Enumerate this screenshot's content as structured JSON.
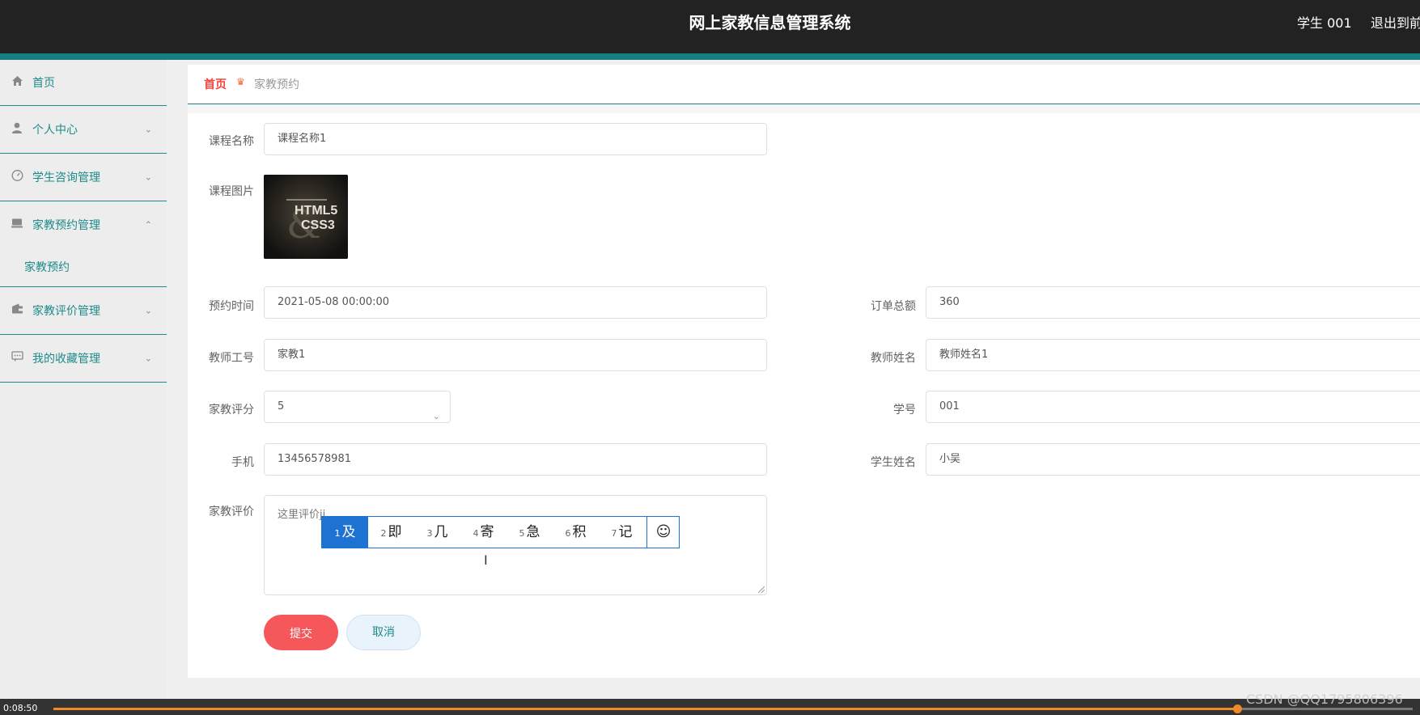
{
  "header": {
    "app_title": "网上家教信息管理系统",
    "user_name": "学生 001",
    "logout_label": "退出到前台"
  },
  "sidebar": {
    "items": [
      {
        "label": "首页",
        "icon": "home-icon"
      },
      {
        "label": "个人中心",
        "icon": "user-icon"
      },
      {
        "label": "学生咨询管理",
        "icon": "dashboard-icon"
      },
      {
        "label": "家教预约管理",
        "icon": "inbox-icon",
        "expanded": true
      },
      {
        "label": "家教评价管理",
        "icon": "wallet-icon"
      },
      {
        "label": "我的收藏管理",
        "icon": "chat-icon"
      }
    ],
    "subitem": {
      "label": "家教预约"
    }
  },
  "breadcrumb": {
    "home": "首页",
    "current": "家教预约"
  },
  "form": {
    "course_name": {
      "label": "课程名称",
      "value": "课程名称1"
    },
    "course_image": {
      "label": "课程图片",
      "line1": "HTML5",
      "line2": "CSS3"
    },
    "booking_time": {
      "label": "预约时间",
      "value": "2021-05-08 00:00:00"
    },
    "order_total": {
      "label": "订单总额",
      "value": "360"
    },
    "teacher_id": {
      "label": "教师工号",
      "value": "家教1"
    },
    "teacher_name": {
      "label": "教师姓名",
      "value": "教师姓名1"
    },
    "rating": {
      "label": "家教评分",
      "value": "5"
    },
    "student_id": {
      "label": "学号",
      "value": "001"
    },
    "phone": {
      "label": "手机",
      "value": "13456578981"
    },
    "student_name": {
      "label": "学生姓名",
      "value": "小吴"
    },
    "review": {
      "label": "家教评价",
      "value": "这里评价ji"
    },
    "submit_label": "提交",
    "cancel_label": "取消"
  },
  "ime": {
    "candidates": [
      {
        "num": "1",
        "char": "及"
      },
      {
        "num": "2",
        "char": "即"
      },
      {
        "num": "3",
        "char": "几"
      },
      {
        "num": "4",
        "char": "寄"
      },
      {
        "num": "5",
        "char": "急"
      },
      {
        "num": "6",
        "char": "积"
      },
      {
        "num": "7",
        "char": "记"
      }
    ],
    "active_index": 0,
    "emoji": "☺"
  },
  "video": {
    "time": "0:08:50",
    "progress": 0.871
  },
  "watermark": "CSDN @QQ1795806396",
  "colors": {
    "accent": "#1f8a8a",
    "topbar": "#222222",
    "submit": "#f5575a",
    "ime": "#1e73d2",
    "progress": "#f08a24"
  }
}
